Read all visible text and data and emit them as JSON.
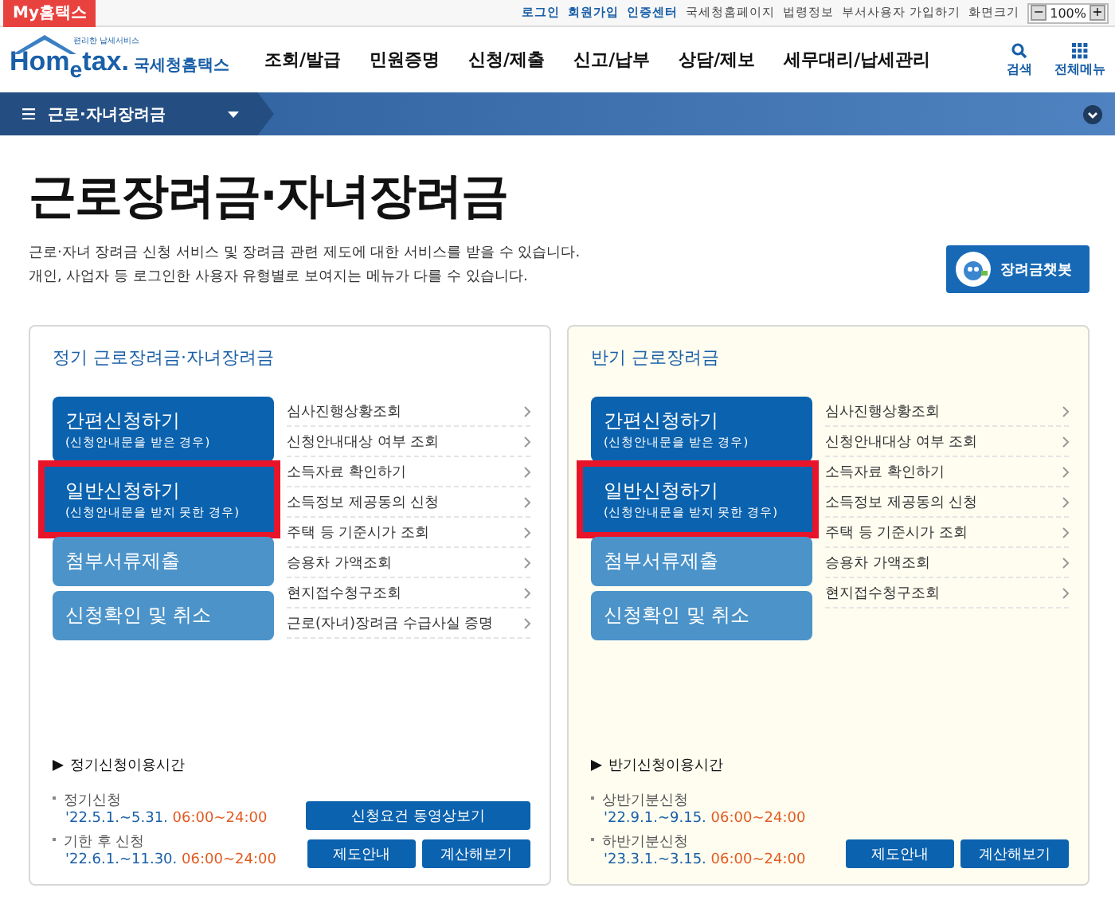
{
  "top_bar": {
    "my_service": "My홈택스",
    "links": [
      {
        "label": "로그인",
        "kind": "strong"
      },
      {
        "label": "회원가입",
        "kind": "strong"
      },
      {
        "label": "인증센터",
        "kind": "strong"
      },
      {
        "label": "국세청홈페이지",
        "kind": "plain"
      },
      {
        "label": "법령정보",
        "kind": "plain"
      },
      {
        "label": "부서사용자 가입하기",
        "kind": "plain"
      },
      {
        "label": "화면크기",
        "kind": "label"
      }
    ],
    "zoom_value": "100%",
    "zoom_out": "−",
    "zoom_in": "+"
  },
  "header": {
    "logo_tagline": "편리한 납세서비스",
    "logo": "Hom$_{e}$tax.",
    "brand": "국세청홈택스",
    "nav": [
      "조회/발급",
      "민원증명",
      "신청/제출",
      "신고/납부",
      "상담/제보",
      "세무대리/납세관리"
    ],
    "tools": [
      {
        "label": "검색",
        "kind": "search"
      },
      {
        "label": "전체메뉴",
        "kind": "grid"
      }
    ]
  },
  "breadcrumb": {
    "label": "근로·자녀장려금"
  },
  "title": "근로장려금·자녀장려금",
  "description": [
    "근로·자녀 장려금 신청 서비스 및 장려금 관련 제도에 대한 서비스를 받을 수 있습니다.",
    "개인, 사업자 등 로그인한 사용자 유형별로 보여지는 메뉴가 다를 수 있습니다."
  ],
  "chatbot": "장려금챗봇",
  "panels": [
    {
      "title": "정기 근로장려금·자녀장려금",
      "color": "#ffffff",
      "main_buttons": [
        {
          "title": "간편신청하기",
          "subtitle": "(신청안내문을 받은 경우)",
          "kind": "primary",
          "highlighted": false
        },
        {
          "title": "일반신청하기",
          "subtitle": "(신청안내문을 받지 못한 경우)",
          "kind": "primary",
          "highlighted": true
        },
        {
          "title": "첨부서류제출",
          "kind": "secondary",
          "highlighted": false
        },
        {
          "title": "신청확인 및 취소",
          "kind": "secondary",
          "highlighted": false
        }
      ],
      "links": [
        "심사진행상황조회",
        "신청안내대상 여부 조회",
        "소득자료 확인하기",
        "소득정보 제공동의 신청",
        "주택 등 기준시가 조회",
        "승용차 가액조회",
        "현지접수청구조회",
        "근로(자녀)장려금 수급사실 증명"
      ],
      "schedule": {
        "heading": "정기신청이용시간",
        "entries": [
          {
            "label": "정기신청",
            "dates": "'22.5.1.~5.31.",
            "time": "06:00~24:00"
          },
          {
            "label": "기한 후 신청",
            "dates": "'22.6.1.~11.30.",
            "time": "06:00~24:00"
          }
        ]
      },
      "actions": [
        {
          "label": "신청요건 동영상보기",
          "wide": true
        },
        {
          "label": "제도안내",
          "wide": false
        },
        {
          "label": "계산해보기",
          "wide": false
        }
      ]
    },
    {
      "title": "반기 근로장려금",
      "color": "#fefdf0",
      "main_buttons": [
        {
          "title": "간편신청하기",
          "subtitle": "(신청안내문을 받은 경우)",
          "kind": "primary",
          "highlighted": false
        },
        {
          "title": "일반신청하기",
          "subtitle": "(신청안내문을 받지 못한 경우)",
          "kind": "primary",
          "highlighted": true
        },
        {
          "title": "첨부서류제출",
          "kind": "secondary",
          "highlighted": false
        },
        {
          "title": "신청확인 및 취소",
          "kind": "secondary",
          "highlighted": false
        }
      ],
      "links": [
        "심사진행상황조회",
        "신청안내대상 여부 조회",
        "소득자료 확인하기",
        "소득정보 제공동의 신청",
        "주택 등 기준시가 조회",
        "승용차 가액조회",
        "현지접수청구조회"
      ],
      "schedule": {
        "heading": "반기신청이용시간",
        "entries": [
          {
            "label": "상반기분신청",
            "dates": "'22.9.1.~9.15.",
            "time": "06:00~24:00"
          },
          {
            "label": "하반기분신청",
            "dates": "'23.3.1.~3.15.",
            "time": "06:00~24:00"
          }
        ]
      },
      "actions": [
        {
          "label": "제도안내",
          "wide": false
        },
        {
          "label": "계산해보기",
          "wide": false
        }
      ]
    }
  ]
}
